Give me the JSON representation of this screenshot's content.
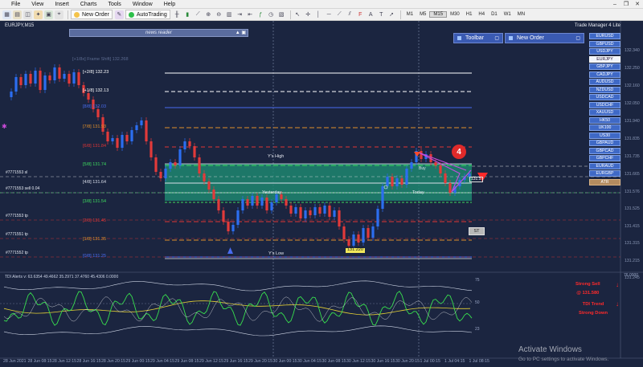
{
  "menu": [
    "File",
    "View",
    "Insert",
    "Charts",
    "Tools",
    "Window",
    "Help"
  ],
  "toolbar": {
    "new_order": "New Order",
    "autotrading": "AutoTrading",
    "timeframes": [
      "M1",
      "M5",
      "M15",
      "M30",
      "H1",
      "H4",
      "D1",
      "W1",
      "MN"
    ],
    "active_timeframe": "M15"
  },
  "chart": {
    "symbol": "EURJPY,M15",
    "trade_manager": "Trade Manager 4 Lite",
    "news_reader": "news reader",
    "toolbar_panel": "Toolbar",
    "new_order_panel": "New Order",
    "faded_label": "[+1/8x] Frame Shift] 132.268",
    "murrey": [
      {
        "label": "[+2/8] 132.23",
        "color": "#ffffff"
      },
      {
        "label": "[+1/8] 132.13",
        "color": "#ffffff"
      },
      {
        "label": "[8/8] 132.03",
        "color": "#4a6cf0"
      },
      {
        "label": "[7/8] 131.93",
        "color": "#e2902a"
      },
      {
        "label": "[6/8] 131.84",
        "color": "#e03535"
      },
      {
        "label": "[5/8] 131.74",
        "color": "#3ddc5e"
      },
      {
        "label": "[4/8] 131.64",
        "color": "#d8dde9"
      },
      {
        "label": "[3/8] 131.54",
        "color": "#3ddc5e"
      },
      {
        "label": "[2/8] 131.45",
        "color": "#e03535"
      },
      {
        "label": "[1/8] 131.35",
        "color": "#e2902a"
      },
      {
        "label": "[0/8] 131.25",
        "color": "#4a6cf0"
      }
    ],
    "hlines": {
      "ys_high": "Y's High",
      "yesterday": "Yesterday",
      "today": "Today",
      "ys_low": "Y's Low",
      "low_tag": "131.220"
    },
    "order_tags": [
      "#7771553 sl",
      "#7771553 sell 0.04",
      "#7771553 tp",
      "#7771551 tp",
      "#7771552 tp"
    ],
    "st_button": "ST",
    "badge": "4",
    "buy_tag": "Buy",
    "last_price_tag": "131.5",
    "y_axis": [
      "132.340",
      "132.250",
      "132.160",
      "132.050",
      "131.940",
      "131.835",
      "131.735",
      "131.665",
      "131.576",
      "131.525",
      "131.415",
      "131.315",
      "131.215",
      "131.245"
    ],
    "x_axis": [
      "28 Jun 2021",
      "28 Jun 08:15",
      "28 Jun 12:15",
      "28 Jun 16:15",
      "28 Jun 20:15",
      "29 Jun 00:15",
      "29 Jun 04:15",
      "29 Jun 08:15",
      "29 Jun 12:15",
      "29 Jun 16:15",
      "29 Jun 20:15",
      "30 Jun 00:15",
      "30 Jun 04:15",
      "30 Jun 08:15",
      "30 Jun 12:15",
      "30 Jun 16:15",
      "30 Jun 20:15",
      "1 Jul 00:15",
      "1 Jul 04:15",
      "1 Jul 08:15"
    ],
    "pairs": [
      "EURUSD",
      "GBPUSD",
      "USDJPY",
      "EURJPY",
      "GBPJPY",
      "CADJPY",
      "AUDUSD",
      "NZDUSD",
      "USDCAD",
      "USDCHF",
      "XAUUSD",
      "HK50",
      "UK100",
      "US30",
      "GBPAUD",
      "GBPCAD",
      "GBPCHF",
      "EURAUD",
      "EURGBP"
    ],
    "active_pair": "EURJPY",
    "atr_label": "ATR"
  },
  "indicator": {
    "title": "TDI Alerts v: 63.6354 49.4662 35.2971 37.4760 45.4306 0.0000",
    "levels": [
      "76.0000",
      "75",
      "50",
      "23"
    ],
    "signal_sell": "Strong Sell",
    "signal_price": "@ 131.580",
    "signal_trend": "TDI Trend",
    "signal_down": "Strong Down"
  },
  "os": {
    "activate": "Activate Windows",
    "activate_sub": "Go to PC settings to activate Windows."
  },
  "colors": {
    "background": "#1b2540",
    "zone": "#1f8a72",
    "bull": "#2c6ef0",
    "bear": "#e23a3a"
  }
}
